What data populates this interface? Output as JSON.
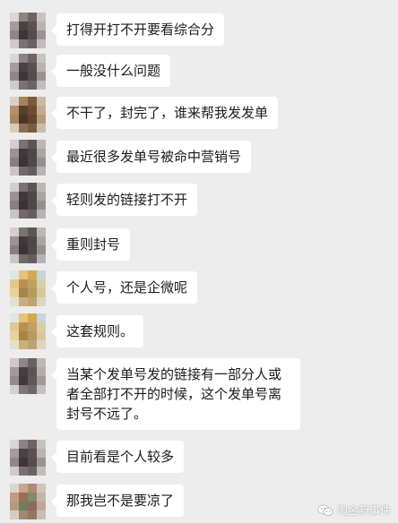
{
  "messages": [
    {
      "text": "打得开打不开要看综合分"
    },
    {
      "text": "一般没什么问题"
    },
    {
      "text": "不干了，封完了，谁来帮我发发单"
    },
    {
      "text": "最近很多发单号被命中营销号"
    },
    {
      "text": "轻则发的链接打不开"
    },
    {
      "text": "重则封号"
    },
    {
      "text": "个人号，还是企微呢"
    },
    {
      "text": "这套规则。"
    },
    {
      "text": "当某个发单号发的链接有一部分人或者全部打不开的时候，这个发单号离封号不远了。"
    },
    {
      "text": "目前看是个人较多"
    },
    {
      "text": "那我岂不是要凉了"
    }
  ],
  "watermark": {
    "text": "淘金新事件",
    "icon": "wechat-icon"
  },
  "colors": {
    "background": "#ededed",
    "bubble": "#ffffff",
    "text": "#1b1b1b"
  }
}
